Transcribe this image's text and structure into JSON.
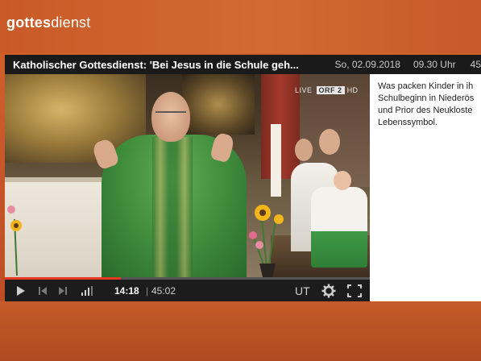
{
  "brand": {
    "name_bold": "gottes",
    "name_light": "dienst"
  },
  "titlebar": {
    "title": "Katholischer Gottesdienst: 'Bei Jesus in die Schule geh...",
    "date": "So, 02.09.2018",
    "time": "09.30 Uhr",
    "duration_partial": "45"
  },
  "video": {
    "live_badge": {
      "prefix": "LIVE",
      "channel": "ORF 2",
      "suffix": "HD"
    }
  },
  "player": {
    "current_time": "14:18",
    "separator": "|",
    "total_time": "45:02",
    "progress_fraction": 0.317,
    "subtitle_label": "UT",
    "icons": [
      "play-icon",
      "previous-icon",
      "next-icon",
      "volume-icon",
      "gear-icon",
      "fullscreen-icon"
    ],
    "accent_color": "#e43a20"
  },
  "description": {
    "lines": [
      "Was packen Kinder in ih",
      "Schulbeginn in Niederös",
      "und Prior des Neukloste",
      "Lebenssymbol."
    ]
  },
  "colors": {
    "brand_orange": "#d2642a",
    "titlebar_bg": "#1a1a1a"
  }
}
